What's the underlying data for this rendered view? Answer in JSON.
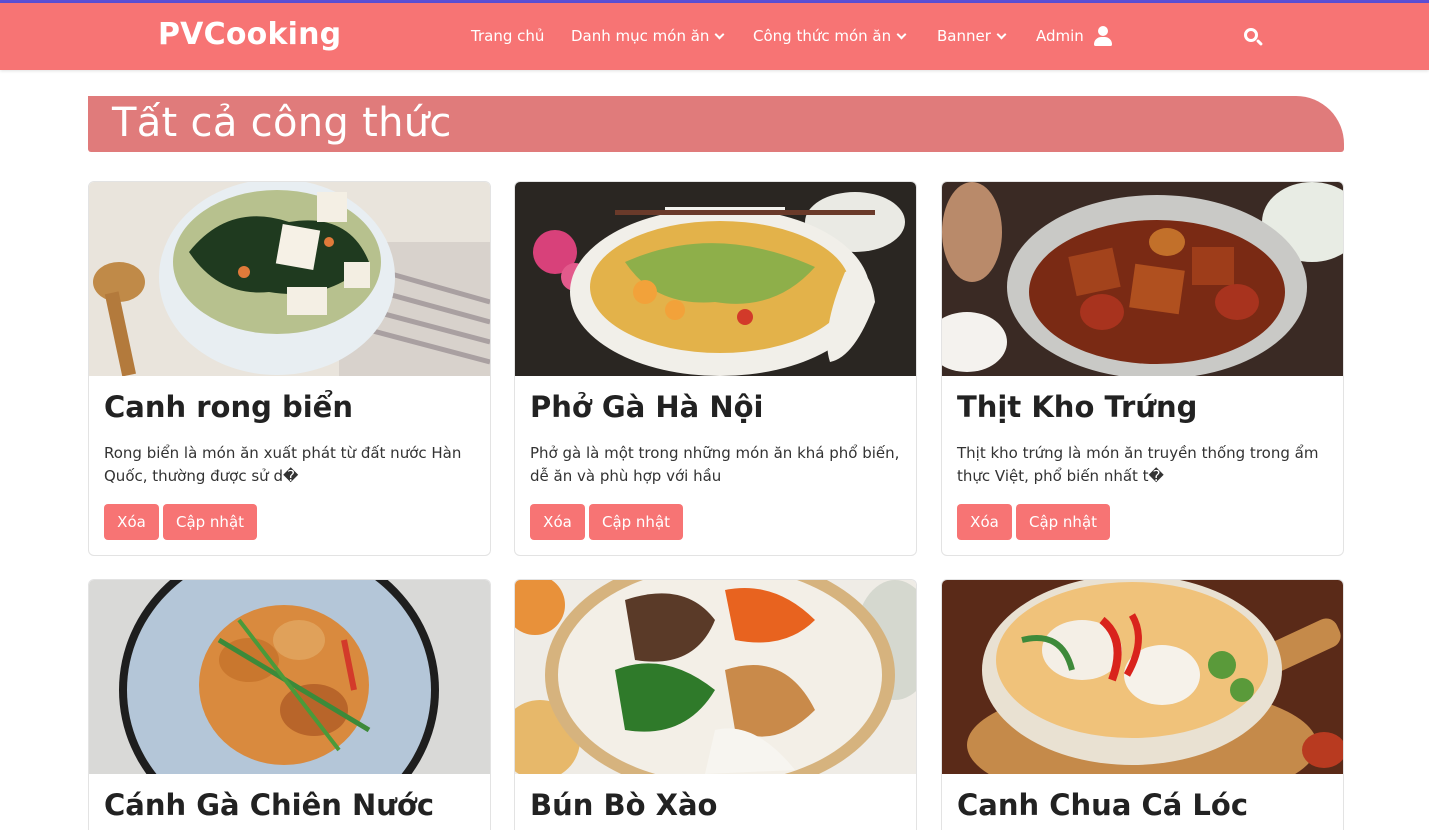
{
  "brand": "PVCooking",
  "nav": {
    "home": "Trang chủ",
    "categories": "Danh mục món ăn",
    "recipes": "Công thức món ăn",
    "banner": "Banner",
    "admin": "Admin"
  },
  "icons": [
    "chevron-down-icon",
    "user-icon",
    "search-icon"
  ],
  "colors": {
    "navbar": "#f77474",
    "section_title": "#e07b7b",
    "button": "#f77474"
  },
  "section_title": "Tất cả công thức",
  "cards": [
    {
      "title": "Canh rong biển",
      "desc": "Rong biển là món ăn xuất phát từ đất nước Hàn Quốc, thường được sử d�",
      "delete": "Xóa",
      "update": "Cập nhật"
    },
    {
      "title": "Phở Gà Hà Nội",
      "desc": "Phở gà là một trong những món ăn khá phổ biến, dễ ăn và phù hợp với hầu",
      "delete": "Xóa",
      "update": "Cập nhật"
    },
    {
      "title": "Thịt Kho Trứng",
      "desc": "Thịt kho trứng là món ăn truyền thống trong ẩm thực Việt, phổ biến nhất t�",
      "delete": "Xóa",
      "update": "Cập nhật"
    },
    {
      "title": "Cánh Gà Chiên Nước"
    },
    {
      "title": "Bún Bò Xào"
    },
    {
      "title": "Canh Chua Cá Lóc"
    }
  ]
}
